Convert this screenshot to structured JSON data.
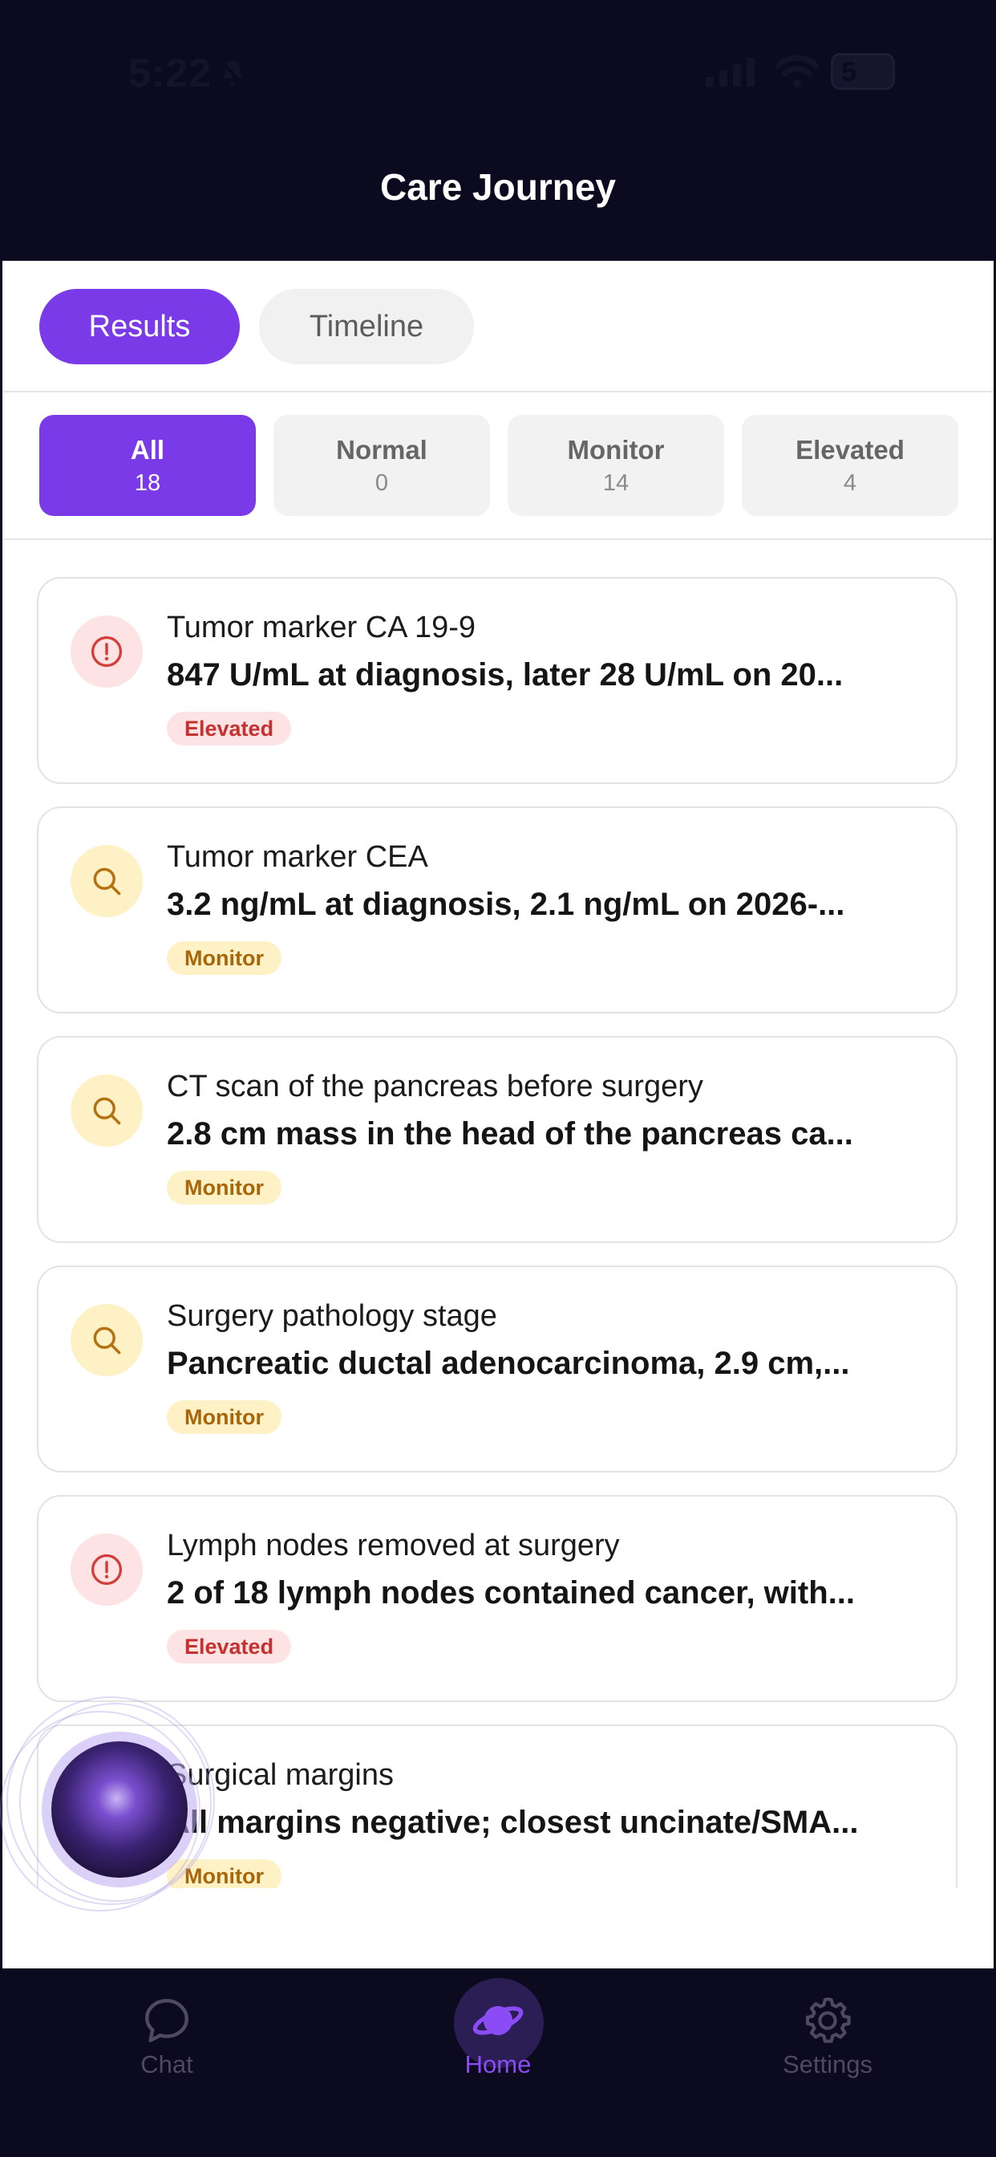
{
  "status_bar": {
    "time": "5:22",
    "battery": "5"
  },
  "header": {
    "title": "Care Journey"
  },
  "view_tabs": [
    {
      "label": "Results",
      "active": true
    },
    {
      "label": "Timeline",
      "active": false
    }
  ],
  "filters": [
    {
      "label": "All",
      "count": "18",
      "active": true
    },
    {
      "label": "Normal",
      "count": "0",
      "active": false
    },
    {
      "label": "Monitor",
      "count": "14",
      "active": false
    },
    {
      "label": "Elevated",
      "count": "4",
      "active": false
    }
  ],
  "results": [
    {
      "title": "Tumor marker CA 19-9",
      "value": "847 U/mL at diagnosis, later 28 U/mL on 20...",
      "status": "Elevated",
      "icon": "alert-circle-icon"
    },
    {
      "title": "Tumor marker CEA",
      "value": "3.2 ng/mL at diagnosis, 2.1 ng/mL on 2026-...",
      "status": "Monitor",
      "icon": "search-icon"
    },
    {
      "title": "CT scan of the pancreas before surgery",
      "value": "2.8 cm mass in the head of the pancreas ca...",
      "status": "Monitor",
      "icon": "search-icon"
    },
    {
      "title": "Surgery pathology stage",
      "value": "Pancreatic ductal adenocarcinoma, 2.9 cm,...",
      "status": "Monitor",
      "icon": "search-icon"
    },
    {
      "title": "Lymph nodes removed at surgery",
      "value": "2 of 18 lymph nodes contained cancer, with...",
      "status": "Elevated",
      "icon": "alert-circle-icon"
    },
    {
      "title": "Surgical margins",
      "value": "All margins negative; closest uncinate/SMA...",
      "status": "Monitor",
      "icon": "search-icon"
    }
  ],
  "tabbar": [
    {
      "label": "Chat",
      "icon": "chat-bubble-icon",
      "active": false
    },
    {
      "label": "Home",
      "icon": "planet-icon",
      "active": true
    },
    {
      "label": "Settings",
      "icon": "gear-icon",
      "active": false
    }
  ],
  "colors": {
    "accent": "#7a3ae8",
    "header_bg": "#0c0a1e",
    "elevated": "#c5312f",
    "monitor": "#a8660a"
  }
}
